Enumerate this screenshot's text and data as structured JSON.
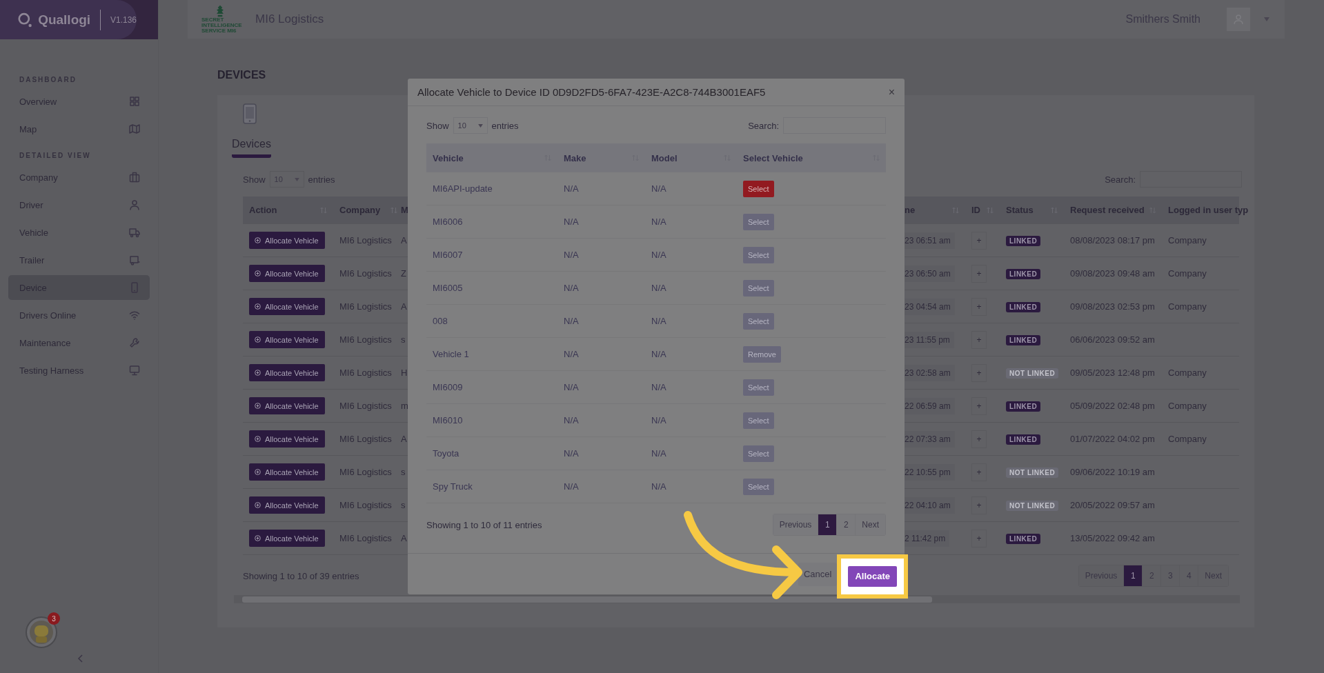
{
  "app": {
    "logo": "Quallogi",
    "version": "V1.136"
  },
  "sidebar": {
    "sections": [
      {
        "heading": "DASHBOARD",
        "items": [
          {
            "label": "Overview",
            "selected": false
          },
          {
            "label": "Map",
            "selected": false
          }
        ]
      },
      {
        "heading": "DETAILED VIEW",
        "items": [
          {
            "label": "Company",
            "selected": false
          },
          {
            "label": "Driver",
            "selected": false
          },
          {
            "label": "Vehicle",
            "selected": false
          },
          {
            "label": "Trailer",
            "selected": false
          },
          {
            "label": "Device",
            "selected": true
          },
          {
            "label": "Drivers Online",
            "selected": false
          },
          {
            "label": "Maintenance",
            "selected": false
          },
          {
            "label": "Testing Harness",
            "selected": false
          }
        ]
      }
    ]
  },
  "assistant": {
    "badge": "3"
  },
  "header": {
    "logo_lines": [
      "SECRET",
      "INTELLIGENCE",
      "SERVICE MI6"
    ],
    "company": "MI6 Logistics",
    "user": "Smithers Smith"
  },
  "page": {
    "title": "DEVICES"
  },
  "devices": {
    "tab": "Devices",
    "show_label": "Show",
    "page_size": "10",
    "entries_label": "entries",
    "search_label": "Search:",
    "columns": [
      "Action",
      "Company",
      "M",
      "ne",
      "ID",
      "Status",
      "Request received",
      "Logged in user typ"
    ],
    "rows": [
      {
        "action": "Allocate Vehicle",
        "company": "MI6 Logistics",
        "column_3": "A",
        "column_4": "23 06:51 am",
        "id": "+",
        "status": "LINKED",
        "linked": true,
        "request_received": "08/08/2023 08:17 pm",
        "logged_in_user_type": "Company"
      },
      {
        "action": "Allocate Vehicle",
        "company": "MI6 Logistics",
        "column_3": "Z",
        "column_4": "23 06:50 am",
        "id": "+",
        "status": "LINKED",
        "linked": true,
        "request_received": "09/08/2023 09:48 am",
        "logged_in_user_type": "Company"
      },
      {
        "action": "Allocate Vehicle",
        "company": "MI6 Logistics",
        "column_3": "A",
        "column_4": "23 04:54 am",
        "id": "+",
        "status": "LINKED",
        "linked": true,
        "request_received": "09/08/2023 02:53 pm",
        "logged_in_user_type": "Company"
      },
      {
        "action": "Allocate Vehicle",
        "company": "MI6 Logistics",
        "column_3": "s",
        "column_4": "23 11:55 pm",
        "id": "+",
        "status": "LINKED",
        "linked": true,
        "request_received": "06/06/2023 09:52 am"
      },
      {
        "action": "Allocate Vehicle",
        "company": "MI6 Logistics",
        "column_3": "H",
        "column_4": "23 02:58 am",
        "id": "+",
        "status": "NOT LINKED",
        "linked": false,
        "request_received": "09/05/2023 12:48 pm",
        "logged_in_user_type": "Company"
      },
      {
        "action": "Allocate Vehicle",
        "company": "MI6 Logistics",
        "column_3": "m",
        "column_4": "22 06:59 am",
        "id": "+",
        "status": "LINKED",
        "linked": true,
        "request_received": "05/09/2022 02:48 pm",
        "logged_in_user_type": "Company"
      },
      {
        "action": "Allocate Vehicle",
        "company": "MI6 Logistics",
        "column_3": "A",
        "column_4": "22 07:33 am",
        "id": "+",
        "status": "LINKED",
        "linked": true,
        "request_received": "01/07/2022 04:02 pm",
        "logged_in_user_type": "Company"
      },
      {
        "action": "Allocate Vehicle",
        "company": "MI6 Logistics",
        "column_3": "s",
        "column_4": "22 10:55 pm",
        "id": "+",
        "status": "NOT LINKED",
        "linked": false,
        "request_received": "09/06/2022 10:19 am"
      },
      {
        "action": "Allocate Vehicle",
        "company": "MI6 Logistics",
        "column_3": "s",
        "column_4": "22 04:10 am",
        "id": "+",
        "status": "NOT LINKED",
        "linked": false,
        "request_received": "20/05/2022 09:57 am"
      },
      {
        "action": "Allocate Vehicle",
        "company": "MI6 Logistics",
        "column_3": "A",
        "column_4": "2 11:42 pm",
        "id": "+",
        "status": "LINKED",
        "linked": true,
        "request_received": "13/05/2022 09:42 am"
      }
    ],
    "info": "Showing 1 to 10 of 39 entries",
    "pagination": [
      {
        "label": "Previous",
        "selected": false
      },
      {
        "label": "1",
        "selected": true
      },
      {
        "label": "2",
        "selected": false
      },
      {
        "label": "3",
        "selected": false
      },
      {
        "label": "4",
        "selected": false
      },
      {
        "label": "Next",
        "selected": false
      }
    ]
  },
  "modal": {
    "title": "Allocate Vehicle to Device ID 0D9D2FD5-6FA7-423E-A2C8-744B3001EAF5",
    "close": "×",
    "show_label": "Show",
    "page_size": "10",
    "entries_label": "entries",
    "search_label": "Search:",
    "columns": [
      "Vehicle",
      "Make",
      "Model",
      "Select Vehicle"
    ],
    "rows": [
      {
        "vehicle": "MI6API-update",
        "make": "N/A",
        "model": "N/A",
        "action": "Select",
        "highlighted": true
      },
      {
        "vehicle": "MI6006",
        "make": "N/A",
        "model": "N/A",
        "action": "Select",
        "highlighted": false
      },
      {
        "vehicle": "MI6007",
        "make": "N/A",
        "model": "N/A",
        "action": "Select",
        "highlighted": false
      },
      {
        "vehicle": "MI6005",
        "make": "N/A",
        "model": "N/A",
        "action": "Select",
        "highlighted": false
      },
      {
        "vehicle": "008",
        "make": "N/A",
        "model": "N/A",
        "action": "Select",
        "highlighted": false
      },
      {
        "vehicle": "Vehicle 1",
        "make": "N/A",
        "model": "N/A",
        "action": "Remove",
        "highlighted": false
      },
      {
        "vehicle": "MI6009",
        "make": "N/A",
        "model": "N/A",
        "action": "Select",
        "highlighted": false
      },
      {
        "vehicle": "MI6010",
        "make": "N/A",
        "model": "N/A",
        "action": "Select",
        "highlighted": false
      },
      {
        "vehicle": "Toyota",
        "make": "N/A",
        "model": "N/A",
        "action": "Select",
        "highlighted": false
      },
      {
        "vehicle": "Spy Truck",
        "make": "N/A",
        "model": "N/A",
        "action": "Select",
        "highlighted": false
      }
    ],
    "info": "Showing 1 to 10 of 11 entries",
    "pagination": [
      {
        "label": "Previous",
        "selected": false
      },
      {
        "label": "1",
        "selected": true
      },
      {
        "label": "2",
        "selected": false
      },
      {
        "label": "Next",
        "selected": false
      }
    ],
    "buttons": [
      {
        "label": "Cancel",
        "kind": "secondary",
        "highlighted": false
      },
      {
        "label": "Allocate",
        "kind": "primary",
        "highlighted": true
      }
    ]
  }
}
